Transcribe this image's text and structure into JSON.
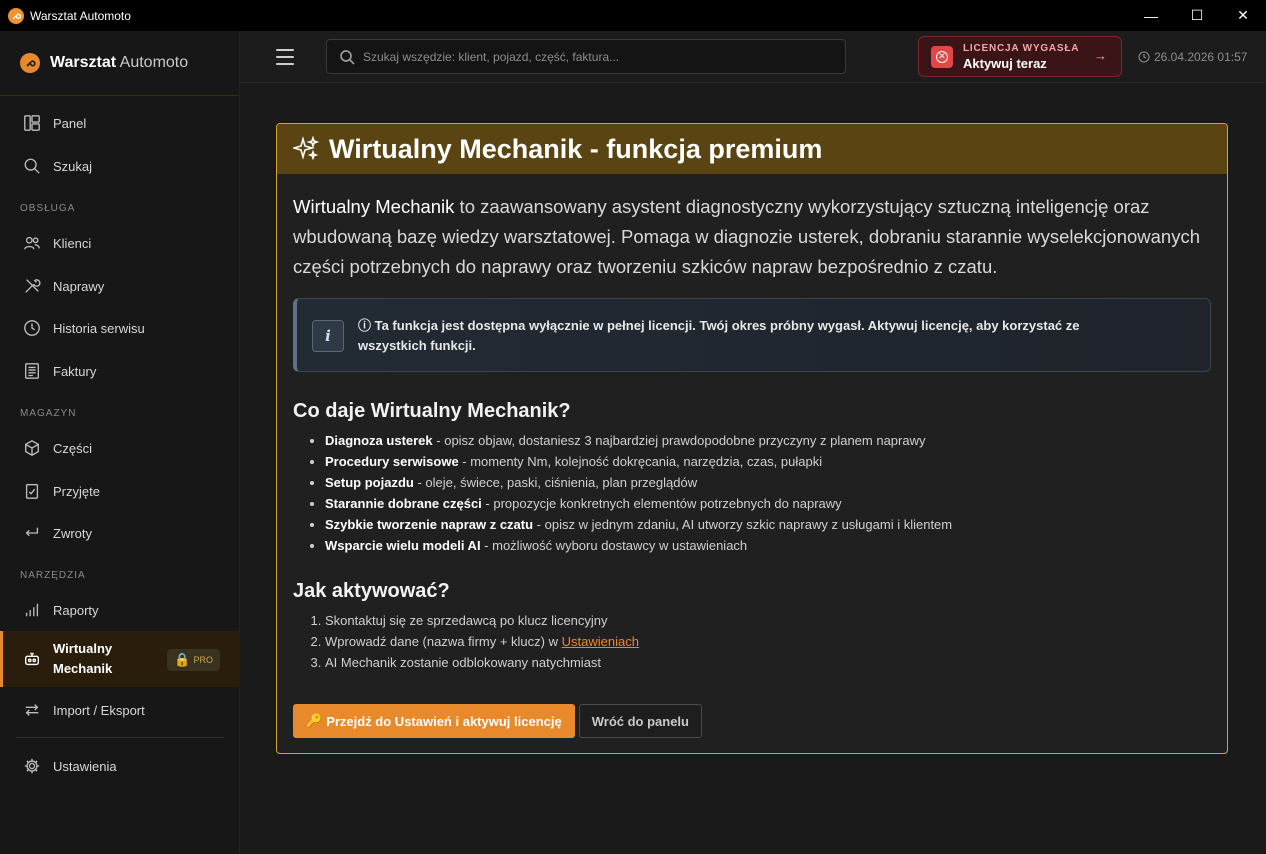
{
  "window": {
    "title": "Warsztat Automoto",
    "controls": {
      "minimize": "—",
      "maximize": "☐",
      "close": "✕"
    }
  },
  "brand": {
    "name_bold": "Warsztat",
    "name_light": " Automoto",
    "accent": "#e8892b"
  },
  "sidebar": {
    "items": [
      {
        "id": "panel",
        "label": "Panel",
        "icon": "dashboard-icon"
      },
      {
        "id": "szukaj",
        "label": "Szukaj",
        "icon": "search-icon"
      },
      {
        "id": "klienci",
        "label": "Klienci",
        "icon": "users-icon"
      },
      {
        "id": "naprawy",
        "label": "Naprawy",
        "icon": "tools-icon"
      },
      {
        "id": "historia",
        "label": "Historia serwisu",
        "icon": "clock-icon"
      },
      {
        "id": "faktury",
        "label": "Faktury",
        "icon": "invoice-icon"
      },
      {
        "id": "czesci",
        "label": "Części",
        "icon": "box-icon"
      },
      {
        "id": "przyjete",
        "label": "Przyjęte",
        "icon": "clipboard-check-icon"
      },
      {
        "id": "zwroty",
        "label": "Zwroty",
        "icon": "return-arrow-icon"
      },
      {
        "id": "raporty",
        "label": "Raporty",
        "icon": "bar-chart-icon"
      },
      {
        "id": "wirtualny",
        "label": "Wirtualny Mechanik",
        "icon": "robot-icon",
        "badge": "PRO",
        "active": true
      },
      {
        "id": "import",
        "label": "Import / Eksport",
        "icon": "swap-arrows-icon"
      },
      {
        "id": "ustawienia",
        "label": "Ustawienia",
        "icon": "gear-icon"
      }
    ],
    "sections": {
      "obsluga": "OBSŁUGA",
      "magazyn": "MAGAZYN",
      "narzedzia": "NARZĘDZIA"
    }
  },
  "topbar": {
    "search_placeholder": "Szukaj wszędzie: klient, pojazd, część, faktura...",
    "license_top": "LICENCJA WYGASŁA",
    "license_bottom": "Aktywuj teraz",
    "datetime": "26.04.2026 01:57"
  },
  "card": {
    "title": "Wirtualny Mechanik - funkcja premium",
    "intro_bold": "Wirtualny Mechanik",
    "intro_rest": " to zaawansowany asystent diagnostyczny wykorzystujący sztuczną inteligencję oraz wbudowaną bazę wiedzy warsztatowej. Pomaga w diagnozie usterek, dobraniu starannie wyselekcjonowanych części potrzebnych do naprawy oraz tworzeniu szkiców napraw bezpośrednio z czatu.",
    "info_icon": "i",
    "info_text": "ⓘ Ta funkcja jest dostępna wyłącznie w pełnej licencji. Twój okres próbny wygasł. Aktywuj licencję, aby korzystać ze wszystkich funkcji.",
    "features_heading": "Co daje Wirtualny Mechanik?",
    "features": [
      {
        "bold": "Diagnoza usterek",
        "rest": " - opisz objaw, dostaniesz 3 najbardziej prawdopodobne przyczyny z planem naprawy"
      },
      {
        "bold": "Procedury serwisowe",
        "rest": " - momenty Nm, kolejność dokręcania, narzędzia, czas, pułapki"
      },
      {
        "bold": "Setup pojazdu",
        "rest": " - oleje, świece, paski, ciśnienia, plan przeglądów"
      },
      {
        "bold": "Starannie dobrane części",
        "rest": " - propozycje konkretnych elementów potrzebnych do naprawy"
      },
      {
        "bold": "Szybkie tworzenie napraw z czatu",
        "rest": " - opisz w jednym zdaniu, AI utworzy szkic naprawy z usługami i klientem"
      },
      {
        "bold": "Wsparcie wielu modeli AI",
        "rest": " - możliwość wyboru dostawcy w ustawieniach"
      }
    ],
    "steps_heading": "Jak aktywować?",
    "steps": {
      "s1": "Skontaktuj się ze sprzedawcą po klucz licencyjny",
      "s2_prefix": "Wprowadź dane (nazwa firmy + klucz) w ",
      "s2_link": "Ustawieniach",
      "s3": "AI Mechanik zostanie odblokowany natychmiast"
    },
    "primary_button": "Przejdź do Ustawień i aktywuj licencję",
    "secondary_button": "Wróć do panelu"
  }
}
